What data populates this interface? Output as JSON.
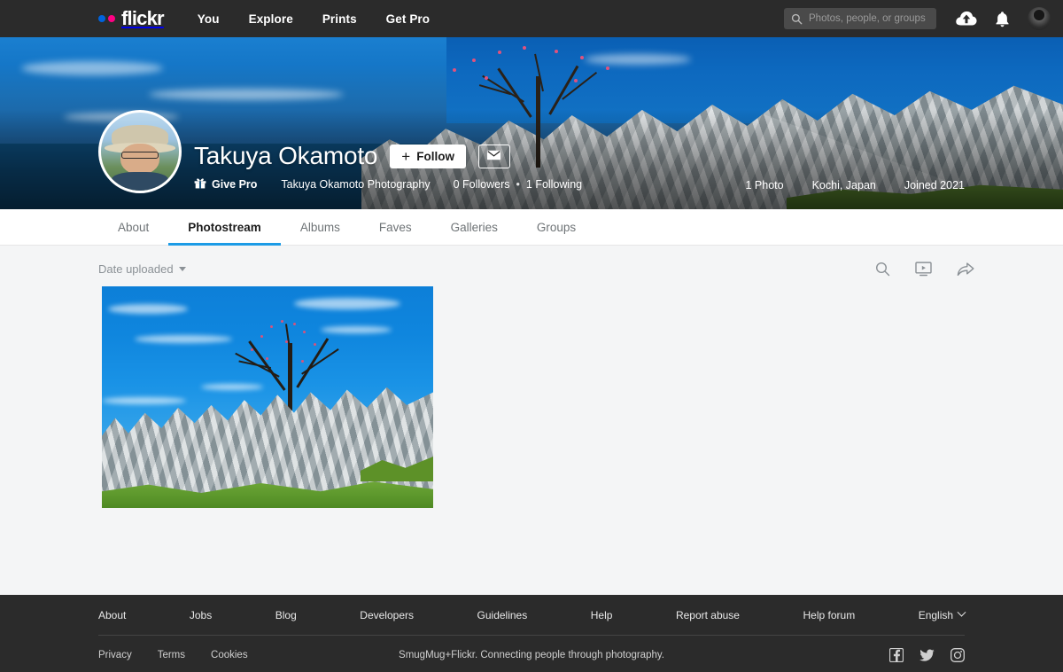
{
  "topnav": {
    "logo_text": "flickr",
    "logo_dot_blue": "#0063DC",
    "logo_dot_pink": "#FF0084",
    "links": [
      {
        "label": "You"
      },
      {
        "label": "Explore"
      },
      {
        "label": "Prints"
      },
      {
        "label": "Get Pro"
      }
    ],
    "search": {
      "placeholder": "Photos, people, or groups",
      "value": ""
    },
    "upload_icon": "cloud-upload-icon",
    "notifications_icon": "bell-icon",
    "avatar_icon": "user-avatar"
  },
  "profile": {
    "name": "Takuya Okamoto",
    "follow_label": "Follow",
    "follow_plus": "+",
    "message_icon": "envelope-icon",
    "give_pro_label": "Give Pro",
    "give_pro_icon": "gift-icon",
    "tagline": "Takuya Okamoto Photography",
    "followers": "0 Followers",
    "separator": "•",
    "following": "1 Following",
    "photo_count": "1 Photo",
    "location": "Kochi, Japan",
    "joined": "Joined 2021"
  },
  "tabs": [
    {
      "label": "About",
      "active": false
    },
    {
      "label": "Photostream",
      "active": true
    },
    {
      "label": "Albums",
      "active": false
    },
    {
      "label": "Faves",
      "active": false
    },
    {
      "label": "Galleries",
      "active": false
    },
    {
      "label": "Groups",
      "active": false
    }
  ],
  "toolbar": {
    "sort_label": "Date uploaded",
    "search_icon": "search-icon",
    "slideshow_icon": "slideshow-icon",
    "share_icon": "share-arrow-icon"
  },
  "photos": [
    {
      "alt": "Cherry blossom tree on white karst rock formation under blue sky"
    }
  ],
  "footer": {
    "links_primary": [
      {
        "label": "About"
      },
      {
        "label": "Jobs"
      },
      {
        "label": "Blog"
      },
      {
        "label": "Developers"
      },
      {
        "label": "Guidelines"
      },
      {
        "label": "Help"
      },
      {
        "label": "Report abuse"
      },
      {
        "label": "Help forum"
      }
    ],
    "language": "English",
    "links_secondary": [
      {
        "label": "Privacy"
      },
      {
        "label": "Terms"
      },
      {
        "label": "Cookies"
      }
    ],
    "tagline": "SmugMug+Flickr. Connecting people through photography.",
    "socials": [
      {
        "name": "facebook-icon"
      },
      {
        "name": "twitter-icon"
      },
      {
        "name": "instagram-icon"
      }
    ]
  },
  "colors": {
    "nav_bg": "#2b2b2b",
    "accent_blue": "#1c9be6",
    "page_bg": "#f4f5f6",
    "footer_bg": "#2b2b2b"
  }
}
